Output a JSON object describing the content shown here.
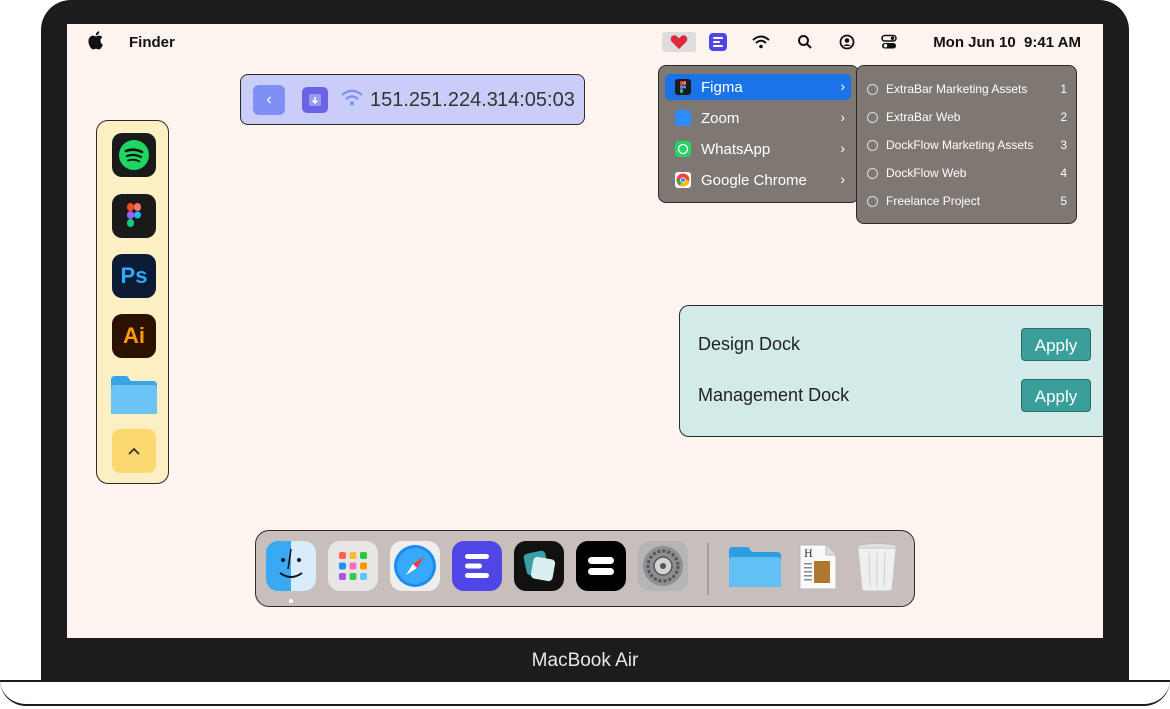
{
  "menubar": {
    "app_name": "Finder",
    "clock": "Mon Jun 10  9:41 AM",
    "icons": [
      "heart-icon",
      "extrabar-icon",
      "wifi-icon",
      "search-icon",
      "user-icon",
      "control-center-icon"
    ]
  },
  "ip_widget": {
    "ip": "151.251.224.3",
    "time": "14:05:03"
  },
  "side_dock": {
    "apps": [
      "spotify",
      "figma",
      "photoshop",
      "illustrator",
      "folder"
    ],
    "ps_label": "Ps",
    "ai_label": "Ai"
  },
  "menu": {
    "items": [
      {
        "label": "Figma",
        "active": true
      },
      {
        "label": "Zoom"
      },
      {
        "label": "WhatsApp"
      },
      {
        "label": "Google Chrome"
      }
    ],
    "submenu": [
      {
        "label": "ExtraBar Marketing Assets",
        "num": "1"
      },
      {
        "label": "ExtraBar Web",
        "num": "2"
      },
      {
        "label": "DockFlow Marketing Assets",
        "num": "3"
      },
      {
        "label": "DockFlow Web",
        "num": "4"
      },
      {
        "label": "Freelance Project",
        "num": "5"
      }
    ]
  },
  "docks_panel": {
    "rows": [
      {
        "label": "Design Dock",
        "button": "Apply"
      },
      {
        "label": "Management Dock",
        "button": "Apply"
      }
    ]
  },
  "dock": {
    "apps": [
      "finder",
      "launchpad",
      "safari",
      "extrabar",
      "screens",
      "dockflow",
      "system-settings",
      "folder",
      "document",
      "trash"
    ]
  },
  "device": {
    "label": "MacBook Air"
  },
  "colors": {
    "menu_active": "#1a73e8",
    "apply_button": "#3a9e9a",
    "screen_bg": "#fdf3ef"
  }
}
